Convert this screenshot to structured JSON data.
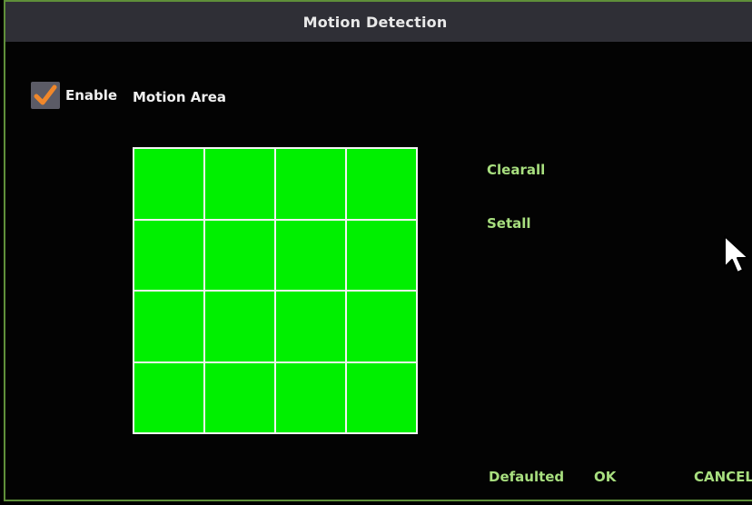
{
  "dialog": {
    "title": "Motion Detection"
  },
  "enable": {
    "label": "Enable",
    "checked": true,
    "check_color": "#f0872a"
  },
  "motion_area": {
    "label": "Motion Area",
    "rows": 4,
    "cols": 4,
    "selected_color": "#00f000",
    "cells": [
      [
        true,
        true,
        true,
        true
      ],
      [
        true,
        true,
        true,
        true
      ],
      [
        true,
        true,
        true,
        true
      ],
      [
        true,
        true,
        true,
        true
      ]
    ]
  },
  "actions": {
    "clearall": "Clearall",
    "setall": "Setall",
    "defaulted": "Defaulted",
    "ok": "OK",
    "cancel": "CANCEL"
  },
  "colors": {
    "accent_text": "#a8df7f",
    "frame": "#5f8f3a",
    "title_bg": "#2f2f36"
  }
}
